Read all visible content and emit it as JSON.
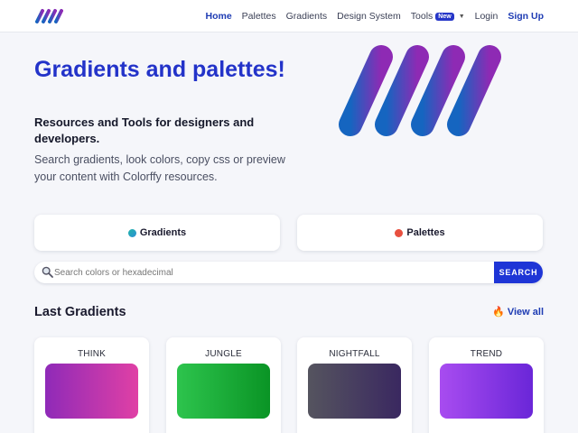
{
  "nav": {
    "items": [
      {
        "label": "Home",
        "active": true
      },
      {
        "label": "Palettes"
      },
      {
        "label": "Gradients"
      },
      {
        "label": "Design System"
      },
      {
        "label": "Tools",
        "badge": "New"
      },
      {
        "label": "Login"
      },
      {
        "label": "Sign Up"
      }
    ]
  },
  "hero": {
    "title": "Gradients and palettes!",
    "subtitle": "Resources and Tools for designers and developers.",
    "description": "Search gradients, look colors, copy css or preview your content with Colorffy resources."
  },
  "toggles": {
    "gradients": {
      "label": "Gradients",
      "dot_color": "#1fb5a8"
    },
    "palettes": {
      "label": "Palettes",
      "dot_color": "#e8503f"
    }
  },
  "search": {
    "placeholder": "Search colors or hexadecimal",
    "value": "",
    "button_label": "SEARCH"
  },
  "last_gradients": {
    "title": "Last Gradients",
    "view_all": "View all",
    "items": [
      {
        "name": "THINK",
        "from": "#8f2ab8",
        "to": "#e040a5"
      },
      {
        "name": "JUNGLE",
        "from": "#2dc44d",
        "to": "#0a9425"
      },
      {
        "name": "NIGHTFALL",
        "from": "#55545f",
        "to": "#3a2860"
      },
      {
        "name": "TREND",
        "from": "#a84cf0",
        "to": "#6a26d8"
      }
    ]
  },
  "icons": {
    "logo": "brand-stripes-logo",
    "search": "magnifier-icon",
    "view_all": "fire-icon"
  },
  "colors": {
    "accent": "#2333c9",
    "button": "#1e35d6",
    "logo_from": "#1565c0",
    "logo_to": "#8e2ab4"
  }
}
